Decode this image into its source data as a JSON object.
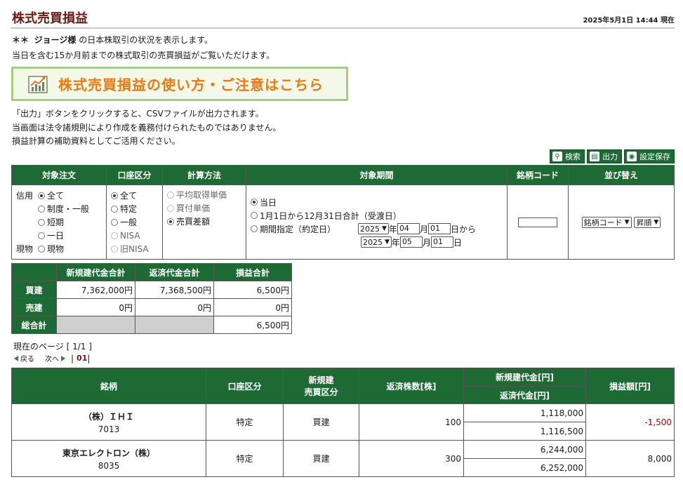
{
  "header": {
    "title": "株式売買損益",
    "datetime": "2025年5月1日 14:44 現在"
  },
  "intro": {
    "name_prefix": "＊＊",
    "user_name": "ジョージ様",
    "line1_suffix": "の日本株取引の状況を表示します。",
    "line2": "当日を含む15か月前までの株式取引の売買損益がご覧いただけます。"
  },
  "banner": {
    "text": "株式売買損益の使い方・ご注意はこちら",
    "icon": "chart-growth-icon"
  },
  "notes": [
    "「出力」ボタンをクリックすると、CSVファイルが出力されます。",
    "当画面は法令諸規則により作成を義務付けられたものではありません。",
    "損益計算の補助資料としてご活用ください。"
  ],
  "toolbar": {
    "search_label": "検索",
    "output_label": "出力",
    "save_settings_label": "設定保存"
  },
  "conditions": {
    "headers": [
      "対象注文",
      "口座区分",
      "計算方法",
      "対象期間",
      "銘柄コード",
      "並び替え"
    ],
    "order": {
      "credit_label": "信用",
      "credit_options": [
        "全て",
        "制度・一般",
        "短期",
        "一日"
      ],
      "credit_selected": "全て",
      "spot_label": "現物",
      "spot_options": [
        "現物"
      ]
    },
    "account_options": [
      "全て",
      "特定",
      "一般",
      "NISA",
      "旧NISA"
    ],
    "account_selected": "全て",
    "calc_options": [
      "平均取得単価",
      "買付単価",
      "売買差額"
    ],
    "calc_selected": "売買差額",
    "period": {
      "options": [
        "当日",
        "1月1日から12月31日合計（受渡日）",
        "期間指定（約定日）"
      ],
      "selected": "当日",
      "from_year": "2025",
      "from_month": "04",
      "from_day": "01",
      "to_year": "2025",
      "to_month": "05",
      "to_day": "01",
      "year_suffix": "年",
      "month_suffix": "月",
      "from_day_suffix": "日から",
      "to_day_suffix": "日"
    },
    "code_value": "",
    "sort_key": "銘柄コード",
    "sort_order": "昇順"
  },
  "summary": {
    "headers": [
      "新規建代金合計",
      "返済代金合計",
      "損益合計"
    ],
    "rows": [
      {
        "label": "買建",
        "new": "7,362,000円",
        "repay": "7,368,500円",
        "pl": "6,500円"
      },
      {
        "label": "売建",
        "new": "0円",
        "repay": "0円",
        "pl": "0円"
      },
      {
        "label": "総合計",
        "new": "",
        "repay": "",
        "pl": "6,500円"
      }
    ]
  },
  "pager": {
    "current": "現在のページ [ 1/1 ]",
    "prev": "戻る",
    "next": "次へ",
    "page": "01"
  },
  "results": {
    "headers": {
      "name": "銘柄",
      "account": "口座区分",
      "trade_type_1": "新規建",
      "trade_type_2": "売買区分",
      "qty": "返済株数[株]",
      "new_amount": "新規建代金[円]",
      "repay_amount": "返済代金[円]",
      "pl": "損益額[円]"
    },
    "rows": [
      {
        "name": "（株）ＩＨＩ",
        "code": "7013",
        "account": "特定",
        "type": "買建",
        "qty": "100",
        "new": "1,118,000",
        "repay": "1,116,500",
        "pl": "-1,500"
      },
      {
        "name": "東京エレクトロン（株）",
        "code": "8035",
        "account": "特定",
        "type": "買建",
        "qty": "300",
        "new": "6,244,000",
        "repay": "6,252,000",
        "pl": "8,000"
      }
    ]
  },
  "colors": {
    "header_green": "#1e6a34",
    "title_brown": "#6b1c10",
    "banner_orange": "#ec7a12",
    "banner_border": "#a6cf7c",
    "negative_red": "#c00000"
  }
}
